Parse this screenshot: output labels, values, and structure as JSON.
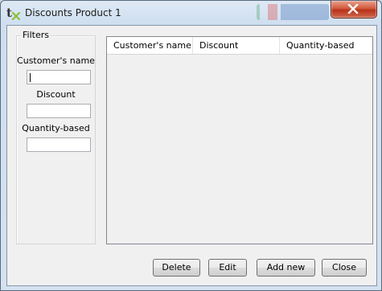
{
  "window": {
    "title": "Discounts Product 1"
  },
  "filters": {
    "legend": "Filters",
    "customer_name_label": "Customer's name",
    "customer_name_value": "",
    "discount_label": "Discount",
    "discount_value": "",
    "quantity_label": "Quantity-based",
    "quantity_value": ""
  },
  "grid": {
    "columns": [
      "Customer's name",
      "Discount",
      "Quantity-based"
    ],
    "rows": []
  },
  "buttons": {
    "delete": "Delete",
    "edit": "Edit",
    "add_new": "Add new",
    "close": "Close"
  },
  "icons": {
    "app": "app-logo-icon",
    "close": "close-icon"
  }
}
